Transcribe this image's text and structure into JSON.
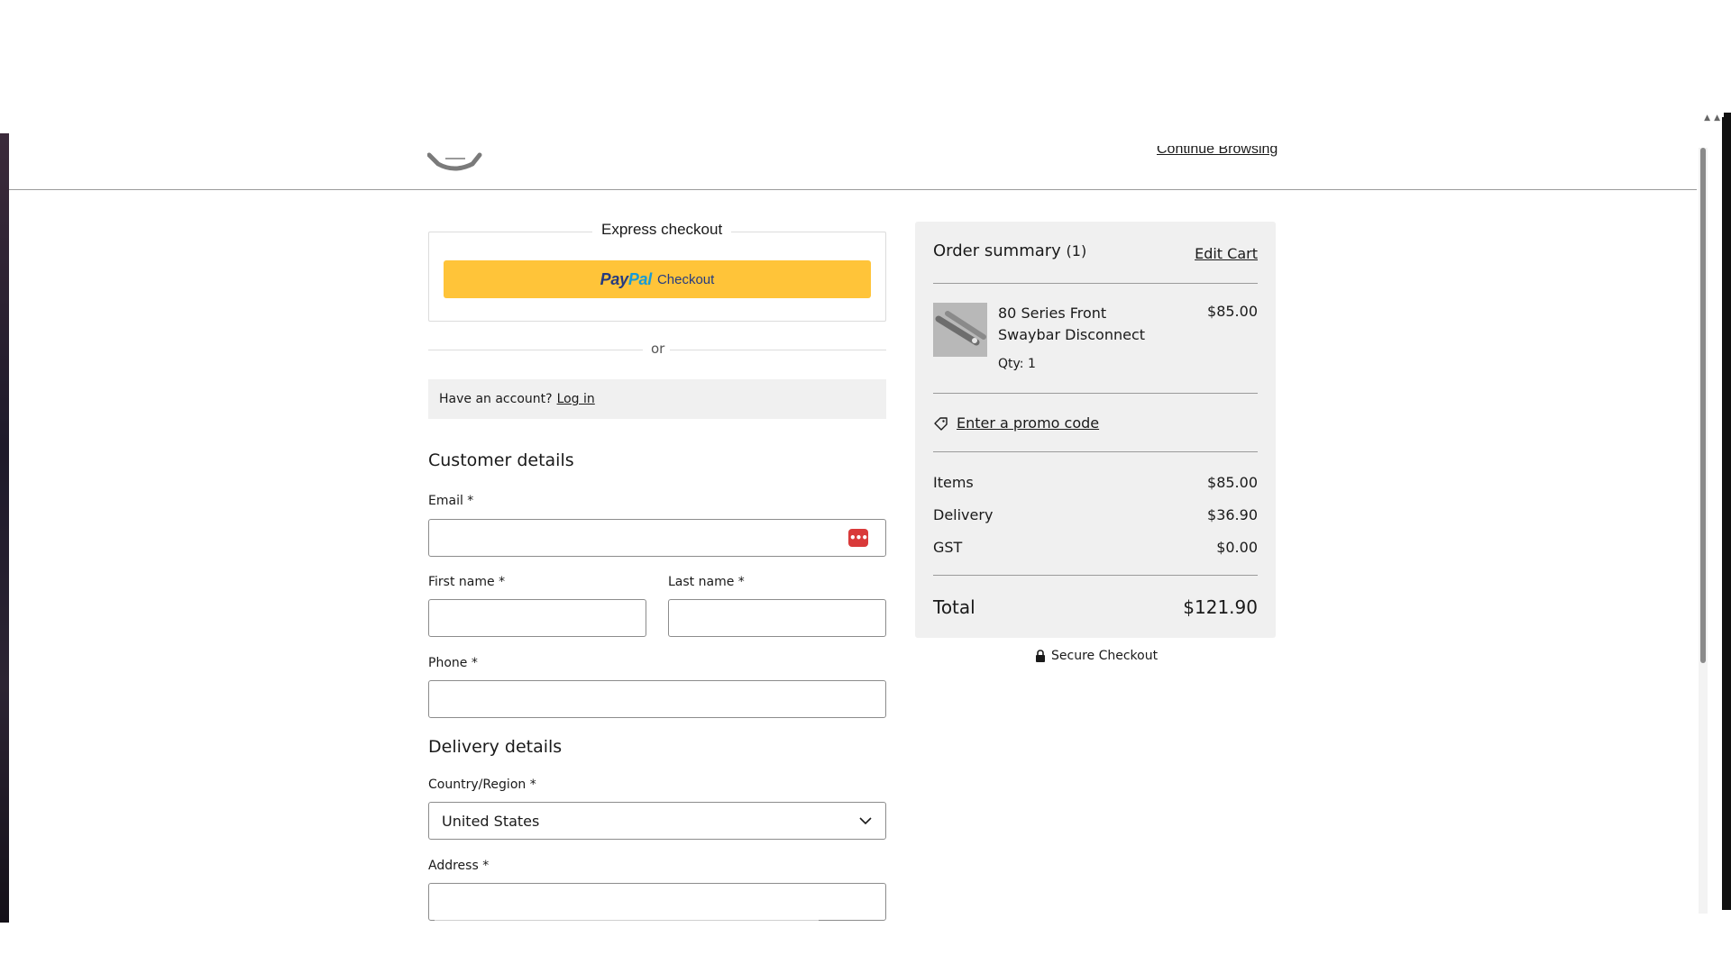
{
  "header": {
    "continue_label": "Continue Browsing"
  },
  "express": {
    "title": "Express checkout",
    "paypal_pay": "Pay",
    "paypal_pal": "Pal",
    "paypal_checkout": "Checkout"
  },
  "divider": {
    "or": "or"
  },
  "account": {
    "prompt": "Have an account?",
    "login": "Log in"
  },
  "customer": {
    "title": "Customer details",
    "email_label": "Email *",
    "email_value": "",
    "first_name_label": "First name *",
    "first_name_value": "",
    "last_name_label": "Last name *",
    "last_name_value": "",
    "phone_label": "Phone *",
    "phone_value": ""
  },
  "delivery": {
    "title": "Delivery details",
    "country_label": "Country/Region *",
    "country_value": "United States",
    "address_label": "Address *",
    "address_value": ""
  },
  "summary": {
    "title": "Order summary",
    "count": "(1)",
    "edit_cart": "Edit Cart",
    "item": {
      "name": "80 Series Front Swaybar Disconnect",
      "price": "$85.00",
      "qty": "Qty: 1"
    },
    "promo": "Enter a promo code",
    "lines": [
      {
        "label": "Items",
        "value": "$85.00"
      },
      {
        "label": "Delivery",
        "value": "$36.90"
      },
      {
        "label": "GST",
        "value": "$0.00"
      }
    ],
    "total_label": "Total",
    "total_value": "$121.90"
  },
  "secure": {
    "label": "Secure Checkout"
  },
  "colors": {
    "paypal_yellow": "#ffc439",
    "paypal_dark_blue": "#253b80",
    "paypal_light_blue": "#179bd7",
    "summary_bg": "#f0f0f0",
    "password_manager_red": "#d93a3a"
  },
  "icons": {
    "password_manager": "password-manager-icon",
    "promo": "tag-icon",
    "secure": "lock-icon",
    "country_select": "chevron-down-icon"
  }
}
